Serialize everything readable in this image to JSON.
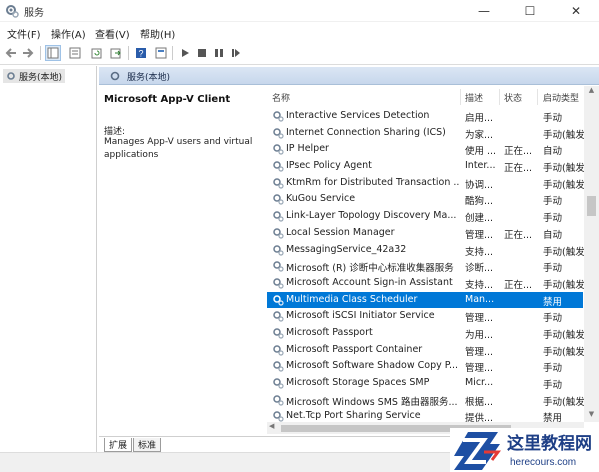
{
  "window": {
    "title": "服务",
    "controls": {
      "minimize": "—",
      "maximize": "☐",
      "close": "✕"
    }
  },
  "menu": [
    "文件(F)",
    "操作(A)",
    "查看(V)",
    "帮助(H)"
  ],
  "toolbar": {
    "icons": [
      "back-icon",
      "forward-icon",
      "show-tree-icon",
      "list-icon",
      "refresh-icon",
      "export-icon",
      "help-icon",
      "properties-icon",
      "start-icon",
      "stop-icon",
      "pause-icon",
      "restart-icon"
    ]
  },
  "tree": {
    "root": "服务(本地)"
  },
  "header": {
    "title": "服务(本地)"
  },
  "details": {
    "service_name": "Microsoft App-V Client",
    "desc_label": "描述:",
    "description": "Manages App-V users and virtual applications"
  },
  "columns": {
    "name": "名称",
    "desc": "描述",
    "status": "状态",
    "start": "启动类型"
  },
  "services": [
    {
      "name": "Interactive Services Detection",
      "desc": "启用...",
      "status": "",
      "start": "手动"
    },
    {
      "name": "Internet Connection Sharing (ICS)",
      "desc": "为家...",
      "status": "",
      "start": "手动(触发"
    },
    {
      "name": "IP Helper",
      "desc": "使用 ...",
      "status": "正在...",
      "start": "自动"
    },
    {
      "name": "IPsec Policy Agent",
      "desc": "Inter...",
      "status": "正在...",
      "start": "手动(触发"
    },
    {
      "name": "KtmRm for Distributed Transaction ...",
      "desc": "协调...",
      "status": "",
      "start": "手动(触发"
    },
    {
      "name": "KuGou Service",
      "desc": "酷狗...",
      "status": "",
      "start": "手动"
    },
    {
      "name": "Link-Layer Topology Discovery Ma...",
      "desc": "创建...",
      "status": "",
      "start": "手动"
    },
    {
      "name": "Local Session Manager",
      "desc": "管理...",
      "status": "正在...",
      "start": "自动"
    },
    {
      "name": "MessagingService_42a32",
      "desc": "支持...",
      "status": "",
      "start": "手动(触发"
    },
    {
      "name": "Microsoft (R) 诊断中心标准收集器服务",
      "desc": "诊断...",
      "status": "",
      "start": "手动"
    },
    {
      "name": "Microsoft Account Sign-in Assistant",
      "desc": "支持...",
      "status": "正在...",
      "start": "手动(触发"
    },
    {
      "name": "Multimedia Class Scheduler",
      "desc": "Man...",
      "status": "",
      "start": "禁用",
      "selected": true
    },
    {
      "name": "Microsoft iSCSI Initiator Service",
      "desc": "管理...",
      "status": "",
      "start": "手动"
    },
    {
      "name": "Microsoft Passport",
      "desc": "为用...",
      "status": "",
      "start": "手动(触发"
    },
    {
      "name": "Microsoft Passport Container",
      "desc": "管理...",
      "status": "",
      "start": "手动(触发"
    },
    {
      "name": "Microsoft Software Shadow Copy P...",
      "desc": "管理...",
      "status": "",
      "start": "手动"
    },
    {
      "name": "Microsoft Storage Spaces SMP",
      "desc": "Micr...",
      "status": "",
      "start": "手动"
    },
    {
      "name": "Microsoft Windows SMS 路由器服务...",
      "desc": "根据...",
      "status": "",
      "start": "手动(触发"
    },
    {
      "name": "Net.Tcp Port Sharing Service",
      "desc": "提供...",
      "status": "",
      "start": "禁用"
    }
  ],
  "tabs": {
    "extended": "扩展",
    "standard": "标准"
  },
  "watermark": {
    "brand": "这里教程网",
    "url": "herecours.com"
  },
  "colors": {
    "selection": "#0078d7",
    "header_bar": "#c7d7ec"
  }
}
